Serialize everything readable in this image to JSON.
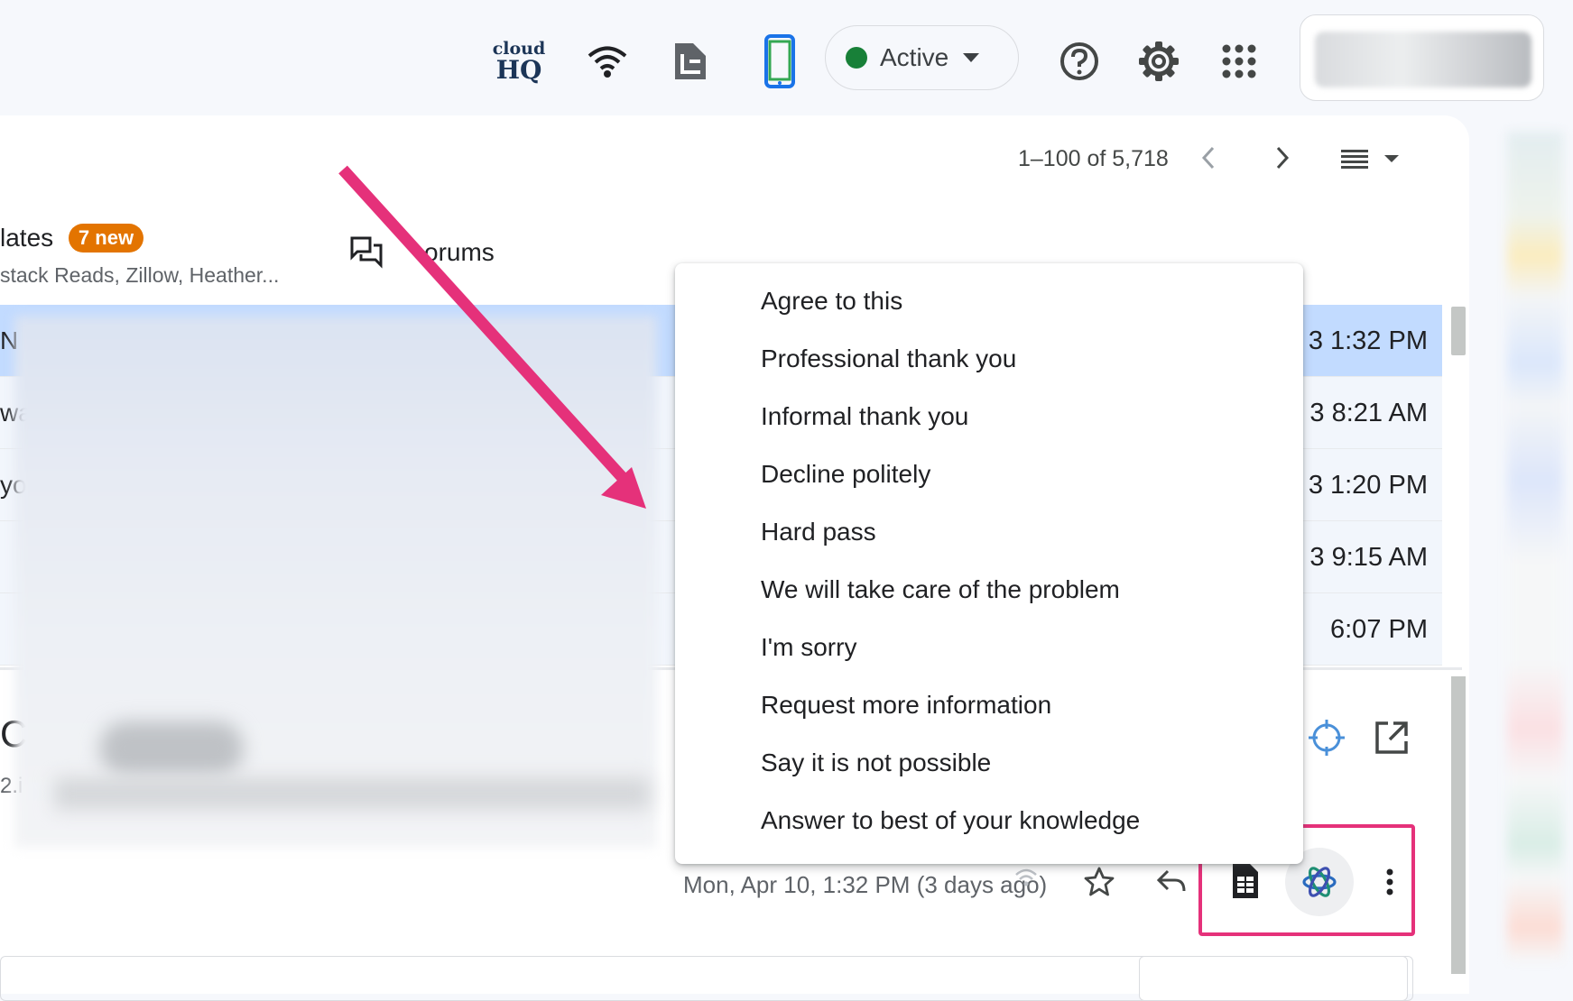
{
  "topbar": {
    "cloudhq_logo_line1": "cloud",
    "cloudhq_logo_line2": "HQ",
    "status_label": "Active",
    "status_color": "#188038"
  },
  "toolbar": {
    "pagination": "1–100 of 5,718"
  },
  "tabs": {
    "updates_label": "lates",
    "updates_badge": "7 new",
    "updates_senders": "stack Reads, Zillow, Heather...",
    "forums_label": "orums"
  },
  "email_list": {
    "rows": [
      {
        "lead": "N",
        "time": "3 1:32 PM",
        "selected": true
      },
      {
        "lead": "wa",
        "time": "3 8:21 AM",
        "selected": false
      },
      {
        "lead": "yo",
        "time": "3 1:20 PM",
        "selected": false
      },
      {
        "lead": "",
        "time": "3 9:15 AM",
        "selected": false
      },
      {
        "lead": "",
        "time": "6:07 PM",
        "selected": false
      }
    ]
  },
  "menu": {
    "items": [
      "Agree to this",
      "Professional thank you",
      "Informal thank you",
      "Decline politely",
      "Hard pass",
      "We will take care of the problem",
      "I'm sorry",
      "Request more information",
      "Say it is not possible",
      "Answer to best of your knowledge"
    ]
  },
  "message": {
    "date": "Mon, Apr 10, 1:32 PM (3 days ago)",
    "subject_initial": "C",
    "sender_fragment": "2.i"
  },
  "colors": {
    "annotation": "#e5317a",
    "badge": "#e37400",
    "selected_row": "#c2dbff"
  }
}
